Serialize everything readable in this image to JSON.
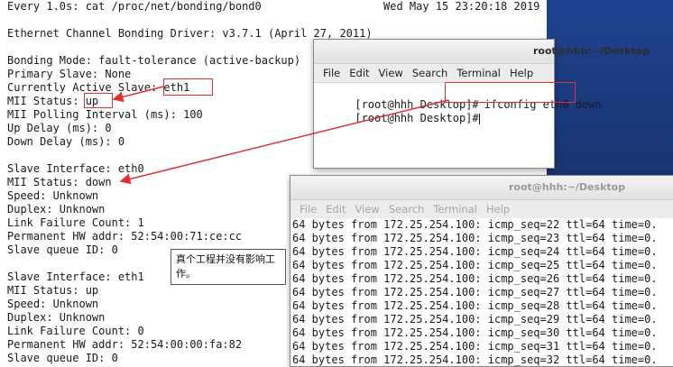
{
  "watch_terminal": {
    "lines": [
      "Every 1.0s: cat /proc/net/bonding/bond0",
      "",
      "Ethernet Channel Bonding Driver: v3.7.1 (April 27, 2011)",
      "",
      "Bonding Mode: fault-tolerance (active-backup)",
      "Primary Slave: None",
      "Currently Active Slave: eth1",
      "MII Status: up",
      "MII Polling Interval (ms): 100",
      "Up Delay (ms): 0",
      "Down Delay (ms): 0",
      "",
      "Slave Interface: eth0",
      "MII Status: down",
      "Speed: Unknown",
      "Duplex: Unknown",
      "Link Failure Count: 1",
      "Permanent HW addr: 52:54:00:71:ce:cc",
      "Slave queue ID: 0",
      "",
      "Slave Interface: eth1",
      "MII Status: up",
      "Speed: Unknown",
      "Duplex: Unknown",
      "Link Failure Count: 0",
      "Permanent HW addr: 52:54:00:00:fa:82",
      "Slave queue ID: 0"
    ],
    "timestamp": "Wed May 15 23:20:18 2019"
  },
  "front_terminal": {
    "title": "root@hhh:~/Desktop",
    "menu": [
      "File",
      "Edit",
      "View",
      "Search",
      "Terminal",
      "Help"
    ],
    "line1_prompt": "[root@hhh Desktop]#",
    "line1_command": "ifconfig eth0 down",
    "line2_prompt": "[root@hhh Desktop]#"
  },
  "ping_terminal": {
    "title": "root@hhh:~/Desktop",
    "menu": [
      "File",
      "Edit",
      "View",
      "Search",
      "Terminal",
      "Help"
    ],
    "lines": [
      "64 bytes from 172.25.254.100: icmp_seq=22 ttl=64 time=0.",
      "64 bytes from 172.25.254.100: icmp_seq=23 ttl=64 time=0.",
      "64 bytes from 172.25.254.100: icmp_seq=24 ttl=64 time=0.",
      "64 bytes from 172.25.254.100: icmp_seq=25 ttl=64 time=0.",
      "64 bytes from 172.25.254.100: icmp_seq=26 ttl=64 time=0.",
      "64 bytes from 172.25.254.100: icmp_seq=27 ttl=64 time=0.",
      "64 bytes from 172.25.254.100: icmp_seq=28 ttl=64 time=0.",
      "64 bytes from 172.25.254.100: icmp_seq=29 ttl=64 time=0.",
      "64 bytes from 172.25.254.100: icmp_seq=30 ttl=64 time=0.",
      "64 bytes from 172.25.254.100: icmp_seq=31 ttl=64 time=0.",
      "64 bytes from 172.25.254.100: icmp_seq=32 ttl=64 time=0."
    ]
  },
  "annotation": {
    "text": "真个工程并没有影响工作。"
  },
  "colors": {
    "highlight": "#e03030",
    "desktop": "#1d3f86"
  }
}
